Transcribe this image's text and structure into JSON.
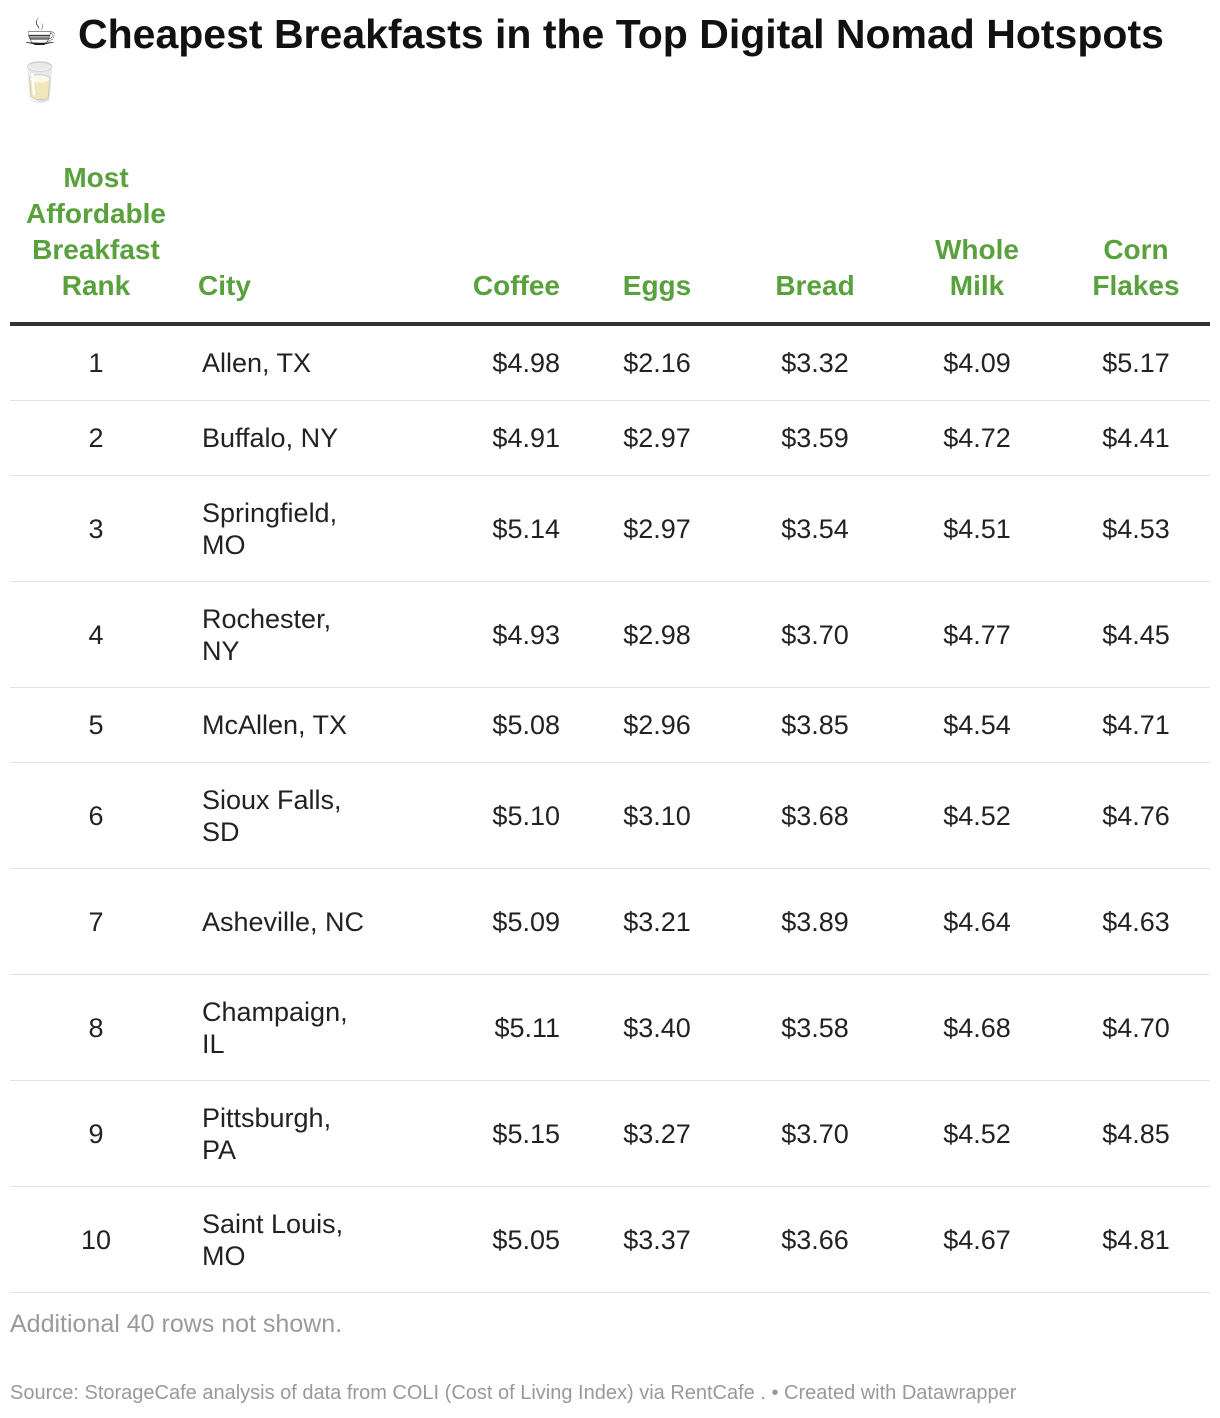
{
  "title": "Cheapest Breakfasts in the Top Digital Nomad Hotspots",
  "title_emojis": [
    "☕",
    "🥛"
  ],
  "colors": {
    "header": "#58a13c",
    "rule": "#333333",
    "row_divider": "#e2e2e2"
  },
  "columns": {
    "rank": "Most Affordable Breakfast Rank",
    "city": "City",
    "coffee": "Coffee",
    "eggs": "Eggs",
    "bread": "Bread",
    "milk": "Whole Milk",
    "cornflakes": "Corn Flakes"
  },
  "rows": [
    {
      "rank": "1",
      "city": "Allen, TX",
      "coffee": "$4.98",
      "eggs": "$2.16",
      "bread": "$3.32",
      "milk": "$4.09",
      "cornflakes": "$5.17"
    },
    {
      "rank": "2",
      "city": "Buffalo, NY",
      "coffee": "$4.91",
      "eggs": "$2.97",
      "bread": "$3.59",
      "milk": "$4.72",
      "cornflakes": "$4.41"
    },
    {
      "rank": "3",
      "city": "Springfield, MO",
      "coffee": "$5.14",
      "eggs": "$2.97",
      "bread": "$3.54",
      "milk": "$4.51",
      "cornflakes": "$4.53"
    },
    {
      "rank": "4",
      "city": "Rochester, NY",
      "coffee": "$4.93",
      "eggs": "$2.98",
      "bread": "$3.70",
      "milk": "$4.77",
      "cornflakes": "$4.45"
    },
    {
      "rank": "5",
      "city": "McAllen, TX",
      "coffee": "$5.08",
      "eggs": "$2.96",
      "bread": "$3.85",
      "milk": "$4.54",
      "cornflakes": "$4.71"
    },
    {
      "rank": "6",
      "city": "Sioux Falls, SD",
      "coffee": "$5.10",
      "eggs": "$3.10",
      "bread": "$3.68",
      "milk": "$4.52",
      "cornflakes": "$4.76"
    },
    {
      "rank": "7",
      "city": "Asheville, NC",
      "coffee": "$5.09",
      "eggs": "$3.21",
      "bread": "$3.89",
      "milk": "$4.64",
      "cornflakes": "$4.63"
    },
    {
      "rank": "8",
      "city": "Champaign, IL",
      "coffee": "$5.11",
      "eggs": "$3.40",
      "bread": "$3.58",
      "milk": "$4.68",
      "cornflakes": "$4.70"
    },
    {
      "rank": "9",
      "city": "Pittsburgh, PA",
      "coffee": "$5.15",
      "eggs": "$3.27",
      "bread": "$3.70",
      "milk": "$4.52",
      "cornflakes": "$4.85"
    },
    {
      "rank": "10",
      "city": "Saint Louis, MO",
      "coffee": "$5.05",
      "eggs": "$3.37",
      "bread": "$3.66",
      "milk": "$4.67",
      "cornflakes": "$4.81"
    }
  ],
  "footer_note": "Additional 40 rows not shown.",
  "source": "Source: StorageCafe analysis of data from COLI (Cost of Living Index) via RentCafe .  • Created with Datawrapper",
  "chart_data": {
    "type": "table",
    "title": "Cheapest Breakfasts in the Top Digital Nomad Hotspots",
    "columns": [
      "Most Affordable Breakfast Rank",
      "City",
      "Coffee",
      "Eggs",
      "Bread",
      "Whole Milk",
      "Corn Flakes"
    ],
    "rows": [
      [
        1,
        "Allen, TX",
        4.98,
        2.16,
        3.32,
        4.09,
        5.17
      ],
      [
        2,
        "Buffalo, NY",
        4.91,
        2.97,
        3.59,
        4.72,
        4.41
      ],
      [
        3,
        "Springfield, MO",
        5.14,
        2.97,
        3.54,
        4.51,
        4.53
      ],
      [
        4,
        "Rochester, NY",
        4.93,
        2.98,
        3.7,
        4.77,
        4.45
      ],
      [
        5,
        "McAllen, TX",
        5.08,
        2.96,
        3.85,
        4.54,
        4.71
      ],
      [
        6,
        "Sioux Falls, SD",
        5.1,
        3.1,
        3.68,
        4.52,
        4.76
      ],
      [
        7,
        "Asheville, NC",
        5.09,
        3.21,
        3.89,
        4.64,
        4.63
      ],
      [
        8,
        "Champaign, IL",
        5.11,
        3.4,
        3.58,
        4.68,
        4.7
      ],
      [
        9,
        "Pittsburgh, PA",
        5.15,
        3.27,
        3.7,
        4.52,
        4.85
      ],
      [
        10,
        "Saint Louis, MO",
        5.05,
        3.37,
        3.66,
        4.67,
        4.81
      ]
    ]
  }
}
